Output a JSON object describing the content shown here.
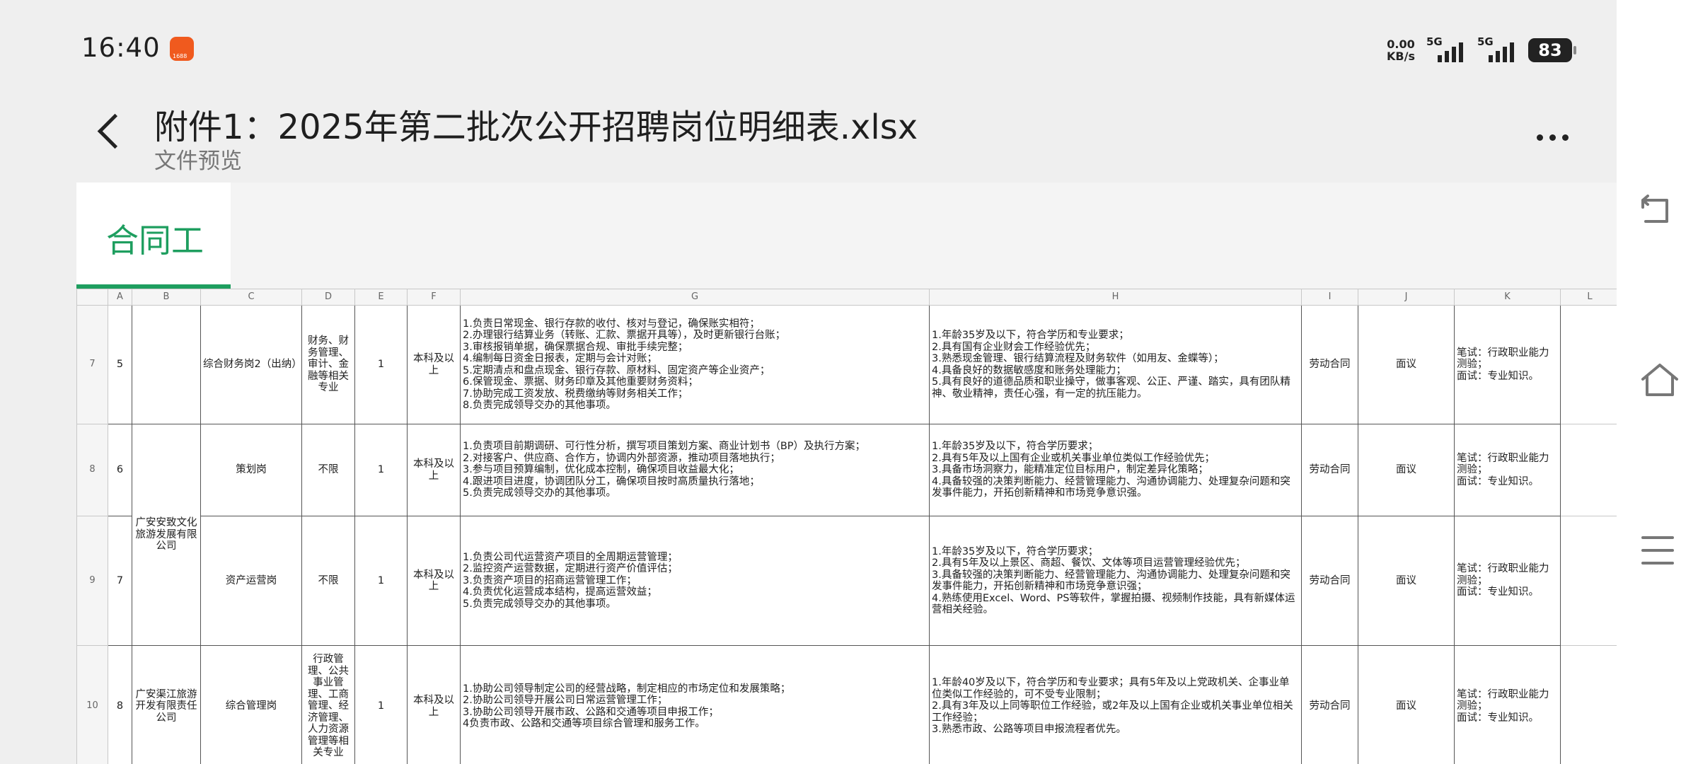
{
  "status_bar": {
    "time": "16:40",
    "net_speed_value": "0.00",
    "net_speed_unit": "KB/s",
    "signal1": "5G",
    "signal2": "5G",
    "battery": "83"
  },
  "header": {
    "title": "附件1：2025年第二批次公开招聘岗位明细表.xlsx",
    "subtitle": "文件预览"
  },
  "sheet_tab": {
    "label": "合同工"
  },
  "columns": [
    "A",
    "B",
    "C",
    "D",
    "E",
    "F",
    "G",
    "H",
    "I",
    "J",
    "K",
    "L"
  ],
  "rows": [
    {
      "num": "7",
      "a": "5",
      "c": "综合财务岗2（出纳）",
      "d": "财务、财务管理、审计、金融等相关专业",
      "e": "1",
      "f": "本科及以上",
      "g": "1.负责日常现金、银行存款的收付、核对与登记，确保账实相符；\n2.办理银行结算业务（转账、汇款、票据开具等），及时更新银行台账；\n3.审核报销单据，确保票据合规、审批手续完整；\n4.编制每日资金日报表，定期与会计对账；\n5.定期清点和盘点现金、银行存款、原材料、固定资产等企业资产；\n6.保管现金、票据、财务印章及其他重要财务资料；\n7.协助完成工资发放、税费缴纳等财务相关工作；\n8.负责完成领导交办的其他事项。",
      "h": "1.年龄35岁及以下，符合学历和专业要求；\n2.具有国有企业财会工作经验优先；\n3.熟悉现金管理、银行结算流程及财务软件（如用友、金蝶等）；\n4.具备良好的数据敏感度和账务处理能力；\n5.具有良好的道德品质和职业操守，做事客观、公正、严谨、踏实，具有团队精神、敬业精神，责任心强，有一定的抗压能力。",
      "i": "劳动合同",
      "j": "面议",
      "k": "笔试：行政职业能力测验；\n面试：专业知识。"
    },
    {
      "num": "8",
      "a": "6",
      "c": "策划岗",
      "d": "不限",
      "e": "1",
      "f": "本科及以上",
      "g": "1.负责项目前期调研、可行性分析，撰写项目策划方案、商业计划书（BP）及执行方案；\n2.对接客户、供应商、合作方，协调内外部资源，推动项目落地执行；\n3.参与项目预算编制，优化成本控制，确保项目收益最大化；\n4.跟进项目进度，协调团队分工，确保项目按时高质量执行落地；\n5.负责完成领导交办的其他事项。",
      "h": "1.年龄35岁及以下，符合学历要求；\n2.具有5年及以上国有企业或机关事业单位类似工作经验优先；\n3.具备市场洞察力，能精准定位目标用户，制定差异化策略；\n4.具备较强的决策判断能力、经营管理能力、沟通协调能力、处理复杂问题和突发事件能力，开拓创新精神和市场竞争意识强。",
      "i": "劳动合同",
      "j": "面议",
      "k": "笔试：行政职业能力测验；\n面试：专业知识。"
    },
    {
      "num": "9",
      "a": "7",
      "c": "资产运营岗",
      "d": "不限",
      "e": "1",
      "f": "本科及以上",
      "g": "1.负责公司代运营资产项目的全周期运营管理；\n2.监控资产运营数据，定期进行资产价值评估；\n3.负责资产项目的招商运营管理工作；\n4.负责优化运营成本结构，提高运营效益；\n5.负责完成领导交办的其他事项。",
      "h": "1.年龄35岁及以下，符合学历要求；\n2.具有5年及以上景区、商超、餐饮、文体等项目运营管理经验优先；\n3.具备较强的决策判断能力、经营管理能力、沟通协调能力、处理复杂问题和突发事件能力，开拓创新精神和市场竞争意识强；\n4.熟练使用Excel、Word、PS等软件，掌握拍摄、视频制作技能，具有新媒体运营相关经验。",
      "i": "劳动合同",
      "j": "面议",
      "k": "笔试：行政职业能力测验；\n面试：专业知识。"
    },
    {
      "num": "10",
      "a": "8",
      "b": "广安渠江旅游开发有限责任公司",
      "c": "综合管理岗",
      "d": "行政管理、公共事业管理、工商管理、经济管理、人力资源管理等相关专业",
      "e": "1",
      "f": "本科及以上",
      "g": "1.协助公司领导制定公司的经营战略，制定相应的市场定位和发展策略；\n2.协助公司领导开展公司日常运营管理工作；\n3.协助公司领导开展市政、公路和交通等项目申报工作；\n4负责市政、公路和交通等项目综合管理和服务工作。",
      "h": "1.年龄40岁及以下，符合学历和专业要求；具有5年及以上党政机关、企事业单位类似工作经验的，可不受专业限制；\n2.具有3年及以上同等职位工作经验，或2年及以上国有企业或机关事业单位相关工作经验；\n3.熟悉市政、公路等项目申报流程者优先。",
      "i": "劳动合同",
      "j": "面议",
      "k": "笔试：行政职业能力测验；\n面试：专业知识。"
    }
  ],
  "merged_company_b": "广安安致文化旅游发展有限公司"
}
